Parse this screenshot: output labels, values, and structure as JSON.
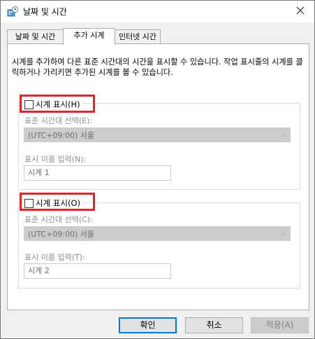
{
  "window": {
    "title": "날짜 및 시간",
    "icon": "clock-settings-icon"
  },
  "tabs": [
    {
      "label": "날짜 및 시간"
    },
    {
      "label": "추가 시계"
    },
    {
      "label": "인터넷 시간"
    }
  ],
  "active_tab": "추가 시계",
  "description": "시계를 추가하여 다른 표준 시간대의 시간을 표시할 수 있습니다. 작업 표시줄의 시계를 클릭하거나 가리키면 추가된 시계를 볼 수 있습니다.",
  "clock1": {
    "show_label": "시계 표시(H)",
    "show_checked": false,
    "timezone_label": "표준 시간대 선택(E):",
    "timezone_value": "(UTC+09:00) 서울",
    "name_label": "표시 이름 입력(N):",
    "name_value": "시계 1"
  },
  "clock2": {
    "show_label": "시계 표시(O)",
    "show_checked": false,
    "timezone_label": "표준 시간대 선택(C):",
    "timezone_value": "(UTC+09:00) 서울",
    "name_label": "표시 이름 입력(T):",
    "name_value": "시계 2"
  },
  "buttons": {
    "ok": "확인",
    "cancel": "취소",
    "apply": "적용(A)"
  },
  "colors": {
    "highlight": "#e0262c",
    "primary_border": "#0078d7"
  }
}
